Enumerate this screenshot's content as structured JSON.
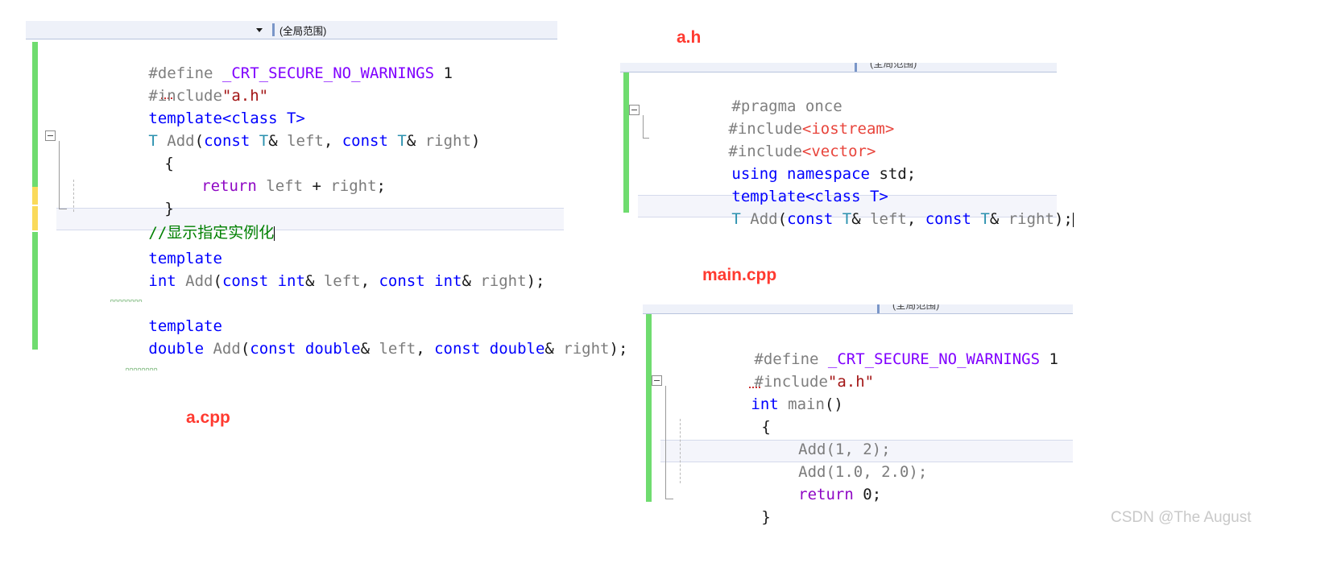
{
  "annotations": [
    {
      "name": "a.cpp",
      "label": "a.cpp"
    },
    {
      "name": "a.h",
      "label": "a.h"
    },
    {
      "name": "main.cpp",
      "label": "main.cpp"
    }
  ],
  "watermark": "CSDN @The  August",
  "panels": {
    "acpp": {
      "title": "a.cpp",
      "scope_label": "(全局范围)",
      "lines": [
        "#define _CRT_SECURE_NO_WARNINGS 1",
        "#include\"a.h\"",
        "template<class T>",
        "T Add(const T& left, const T& right)",
        "{",
        "    return left + right;",
        "}",
        "//显示指定实例化",
        "template",
        "int Add(const int& left, const int& right);",
        "",
        "template",
        "double Add(const double& left, const double& right);"
      ],
      "current_line_text": "//显示指定实例化",
      "gutter": [
        "green",
        "green",
        "green",
        "green",
        "green",
        "green",
        "yellow",
        "yellow",
        "green",
        "green",
        "green",
        "green",
        "green"
      ]
    },
    "ah": {
      "title": "a.h",
      "scope_label": "(全局范围)",
      "lines": [
        "#pragma once",
        "#include<iostream>",
        "#include<vector>",
        "using namespace std;",
        "template<class T>",
        "T Add(const T& left, const T& right);"
      ],
      "current_line_text": "T Add(const T& left, const T& right);",
      "gutter": [
        "green",
        "green",
        "green",
        "green",
        "green",
        "green"
      ]
    },
    "maincpp": {
      "title": "main.cpp",
      "scope_label": "(全局范围)",
      "lines": [
        "#define _CRT_SECURE_NO_WARNINGS 1",
        "#include\"a.h\"",
        "int main()",
        "{",
        "    Add(1, 2);",
        "    Add(1.0, 2.0);",
        "    return 0;",
        "}"
      ],
      "current_line_text": "    Add(1.0, 2.0);",
      "gutter": [
        "green",
        "green",
        "green",
        "green",
        "green",
        "green",
        "green",
        "green"
      ]
    }
  },
  "tokens": {
    "define": "#define",
    "include": "#include",
    "pragma_once": "#pragma once",
    "crt_macro": "_CRT_SECURE_NO_WARNINGS",
    "one": "1",
    "ah_quoted": "\"a.h\"",
    "iostream": "<iostream>",
    "vector": "<vector>",
    "using": "using",
    "namespace": "namespace",
    "std": "std;",
    "template": "template",
    "template_class_t": "template<class T>",
    "kw_const": "const",
    "kw_int": "int",
    "kw_double": "double",
    "kw_return": "return",
    "type_T": "T",
    "fn_Add": "Add",
    "arg_left": "left",
    "arg_right": "right",
    "comment_cn": "//显示指定实例化",
    "main_fn": "main",
    "zero": "0",
    "add_call_int": "Add(1, 2);",
    "add_call_double": "Add(1.0, 2.0);"
  },
  "colors": {
    "annotation_red": "#ff3a30",
    "comment_green": "#008000",
    "keyword_blue": "#0000ff",
    "macro_purple": "#8000ff",
    "string_red": "#a31515",
    "angle_red": "#e8453c",
    "type_teal": "#2b91af",
    "return_purple": "#8f08c4",
    "gutter_green": "#6fdc6f",
    "gutter_yellow": "#fada5a",
    "watermark_gray": "#c9c9c9"
  }
}
